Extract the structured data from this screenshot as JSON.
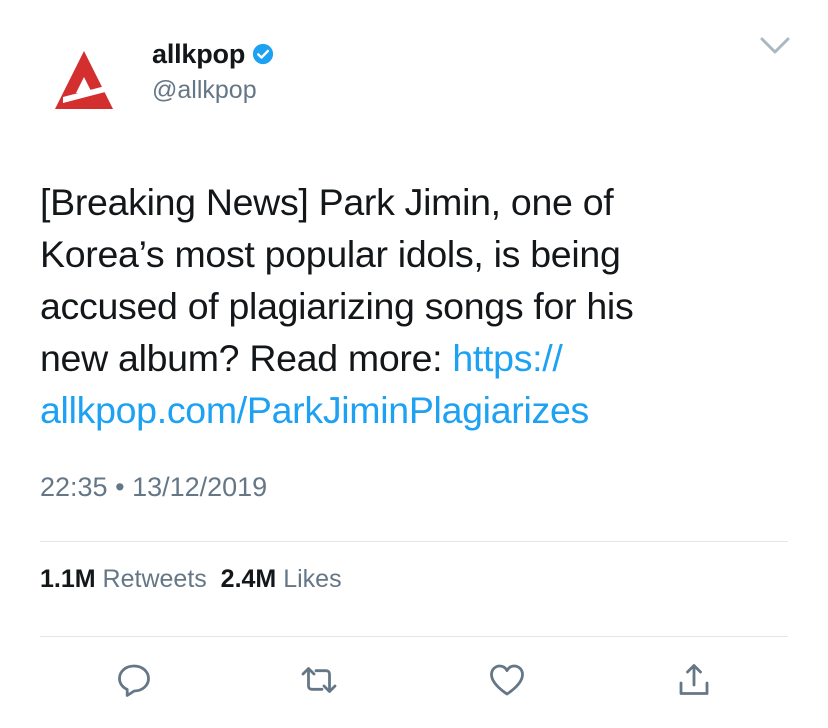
{
  "tweet": {
    "author": {
      "display_name": "allkpop",
      "handle": "@allkpop",
      "verified": true,
      "avatar_icon": "allkpop-logo",
      "avatar_color": "#d32f2f"
    },
    "text_lines": [
      "[Breaking News] Park Jimin, one of",
      "Korea’s most popular idols, is being",
      "accused of plagiarizing songs for his",
      "new album? Read more: "
    ],
    "link_part1": "https://",
    "link_part2": "allkpop.com/ParkJiminPlagiarizes",
    "time": "22:35",
    "separator": "•",
    "date": "13/12/2019",
    "stats": {
      "retweets_count": "1.1M",
      "retweets_label": "Retweets",
      "likes_count": "2.4M",
      "likes_label": "Likes"
    },
    "actions": [
      "reply-icon",
      "retweet-icon",
      "like-icon",
      "share-icon"
    ]
  },
  "colors": {
    "link": "#1da1f2",
    "secondary_text": "#657786",
    "verified_badge": "#1da1f2",
    "divider": "#e1e8ed"
  }
}
